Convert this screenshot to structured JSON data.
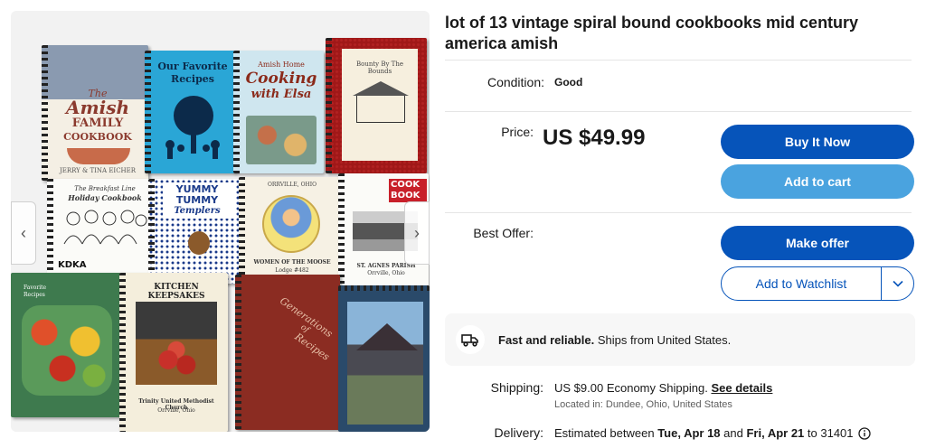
{
  "listing": {
    "title": "lot of 13 vintage spiral bound cookbooks mid century america amish"
  },
  "condition": {
    "label": "Condition:",
    "value": "Good"
  },
  "price": {
    "label": "Price:",
    "value": "US $49.99"
  },
  "buttons": {
    "buy_now": "Buy It Now",
    "add_to_cart": "Add to cart",
    "make_offer": "Make offer",
    "watchlist": "Add to Watchlist"
  },
  "best_offer": {
    "label": "Best Offer:"
  },
  "shipping_banner": {
    "bold": "Fast and reliable.",
    "text": " Ships from United States."
  },
  "shipping": {
    "label": "Shipping:",
    "cost": "US $9.00",
    "service": " Economy Shipping.",
    "details_link": "See details",
    "location": "Located in: Dundee, Ohio, United States"
  },
  "delivery": {
    "label": "Delivery:",
    "prefix": "Estimated between ",
    "start": "Tue, Apr 18",
    "and": " and ",
    "end": "Fri, Apr 21",
    "to": " to 31401"
  },
  "gallery": {
    "books": {
      "amish": {
        "line1": "The",
        "line2": "Amish",
        "line3": "FAMILY",
        "line4": "COOKBOOK",
        "author": "JERRY & TINA EICHER"
      },
      "favorite": {
        "line1": "Our Favorite",
        "line2": "Recipes"
      },
      "elsa": {
        "line1": "Amish Home",
        "line2": "Cooking",
        "line3": "with Elsa"
      },
      "bounty": {
        "line1": "Bounty By The Bounds"
      },
      "breakfast": {
        "line1": "The Breakfast Line",
        "line2": "Holiday Cookbook",
        "badge": "KDKA"
      },
      "yummy": {
        "line1": "YUMMY",
        "line2": "TUMMY",
        "line3": "Templers"
      },
      "moose": {
        "line1": "ORRVILLE, OHIO",
        "line2": "WOMEN OF THE MOOSE",
        "line3": "Lodge #482"
      },
      "agnes": {
        "line1": "COOK",
        "line2": "BOOK",
        "line3": "ST. AGNES PARISH",
        "line4": "Orrville, Ohio"
      },
      "veg": {
        "line1": "Favorite",
        "line2": "Recipes"
      },
      "kitchen": {
        "line1": "KITCHEN KEEPSAKES",
        "line2": "Trinity United Methodist Church",
        "line3": "Orrville, Ohio"
      },
      "generations": {
        "line1": "Generations",
        "line2": "of",
        "line3": "Recipes"
      }
    }
  },
  "colors": {
    "primary": "#0654ba",
    "secondary": "#4aa3df",
    "text": "#191919"
  }
}
